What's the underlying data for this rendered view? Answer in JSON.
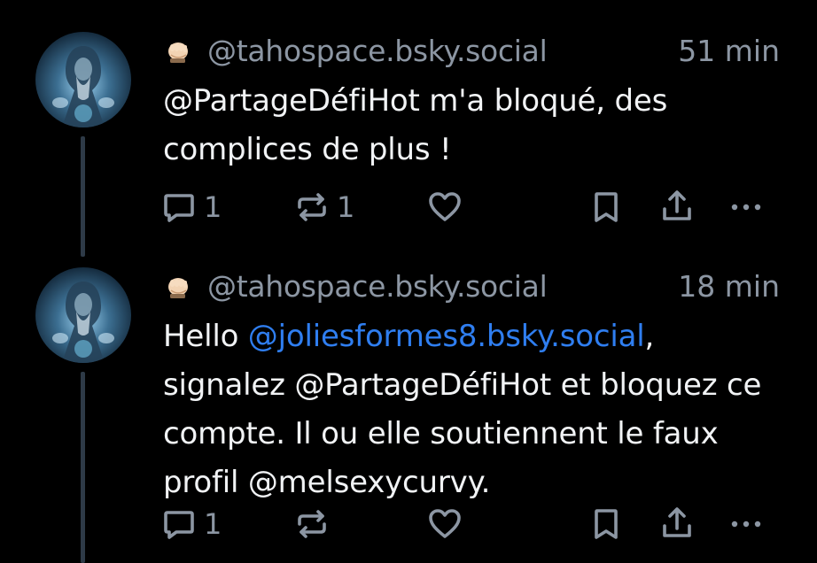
{
  "posts": [
    {
      "handle": "@tahospace.bsky.social",
      "time": "51 min",
      "text": "@PartageDéfiHot m'a bloqué, des complices de plus !",
      "text_parts": [
        {
          "text": "@PartageDéfiHot m'a bloqué, des complices de plus !",
          "mention": false
        }
      ],
      "replies": "1",
      "reposts": "1",
      "likes": ""
    },
    {
      "handle": "@tahospace.bsky.social",
      "time": "18 min",
      "text_parts": [
        {
          "text": "Hello ",
          "mention": false
        },
        {
          "text": "@joliesformes8.bsky.social",
          "mention": true
        },
        {
          "text": ", signalez @PartageDéfiHot et bloquez ce compte. Il ou elle soutiennent le faux profil @melsexycurvy.",
          "mention": false
        }
      ],
      "replies": "1",
      "reposts": "",
      "likes": ""
    }
  ],
  "icons": {
    "emoji": "fist-emoji-icon",
    "reply": "reply-icon",
    "repost": "repost-icon",
    "like": "heart-icon",
    "bookmark": "bookmark-icon",
    "share": "share-icon",
    "more": "more-icon"
  },
  "colors": {
    "background": "#000000",
    "text": "#f1f3f5",
    "muted": "#8c96a3",
    "mention": "#2f7ef0",
    "thread_line": "#2e3a47"
  }
}
